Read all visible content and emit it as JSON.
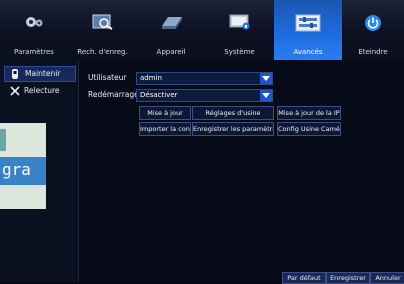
{
  "topbar": {
    "tabs": [
      {
        "label": "Paramètres",
        "icon": "camera-settings-icon"
      },
      {
        "label": "Rech. d'enreg.",
        "icon": "search-record-icon"
      },
      {
        "label": "Appareil",
        "icon": "hard-disk-icon"
      },
      {
        "label": "Système",
        "icon": "system-monitor-icon"
      },
      {
        "label": "Avancés",
        "icon": "advanced-icon"
      },
      {
        "label": "Eteindre",
        "icon": "power-icon"
      }
    ]
  },
  "sidebar": {
    "items": [
      {
        "label": "Maintenir",
        "icon": "maintain-icon"
      },
      {
        "label": "Relecture",
        "icon": "tools-icon"
      }
    ]
  },
  "form": {
    "user_label": "Utilisateur",
    "user_value": "admin",
    "reboot_label": "Redémarrage",
    "reboot_value": "Désactiver"
  },
  "buttons": {
    "update": "Mise à jour",
    "factory": "Réglages d'usine",
    "ip_update": "Mise à jour de la IP",
    "import": "Importer la config",
    "save_params": "Enregistrer les paramètres",
    "usine_config": "Config Usine Caméra"
  },
  "footer": {
    "default": "Par défaut",
    "save": "Enregistrer",
    "cancel": "Annuler"
  },
  "overlay": {
    "text": "gra"
  }
}
